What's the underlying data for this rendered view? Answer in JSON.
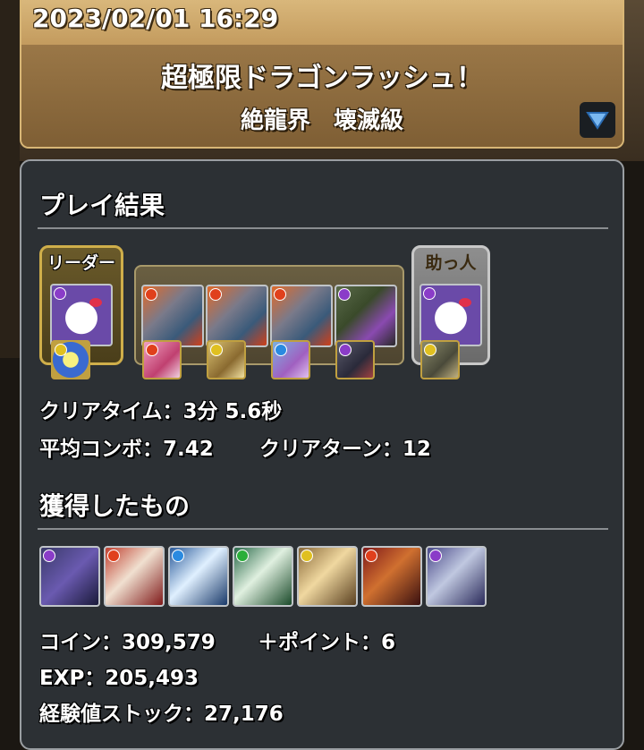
{
  "header": {
    "datetime": "2023/02/01 16:29",
    "dungeon_name": "超極限ドラゴンラッシュ！",
    "difficulty": "絶龍界　壊滅級"
  },
  "play_result": {
    "title": "プレイ結果",
    "leader_label": "リーダー",
    "helper_label": "助っ人",
    "clear_time": "クリアタイム：3分 5.6秒",
    "avg_combo": "平均コンボ：7.42",
    "clear_turn": "クリアターン：12"
  },
  "obtained": {
    "title": "獲得したもの",
    "coin": "コイン：309,579",
    "plus_point": "＋ポイント：6",
    "exp": "EXP：205,493",
    "exp_stock": "経験値ストック：27,176"
  },
  "colors": {
    "panel_bg": "#2c3034",
    "header_gold": "#d9b77b",
    "leader_border": "#cfae4a",
    "helper_border": "#c8c8c8"
  }
}
